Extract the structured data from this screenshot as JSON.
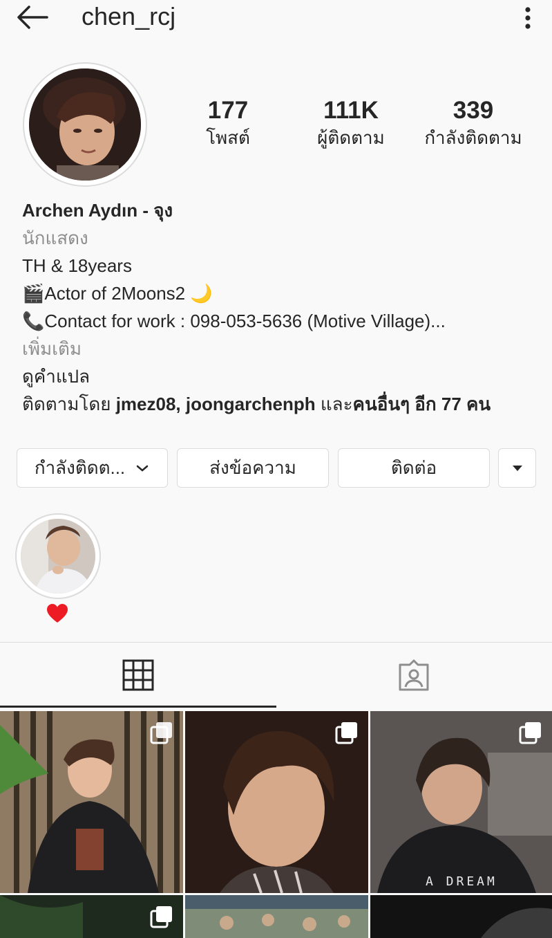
{
  "header": {
    "username": "chen_rcj",
    "back_icon": "arrow-left-icon",
    "more_icon": "more-vertical-icon"
  },
  "profile": {
    "stats": [
      {
        "value": "177",
        "label": "โพสต์"
      },
      {
        "value": "111K",
        "label": "ผู้ติดตาม"
      },
      {
        "value": "339",
        "label": "กำลังติดตาม"
      }
    ],
    "name": "Archen Aydın - จุง",
    "category": "นักแสดง",
    "bio_lines": [
      "TH & 18years",
      "🎬Actor of 2Moons2 🌙",
      "📞Contact for work : 098-053-5636 (Motive Village)..."
    ],
    "more_link": "เพิ่มเติม",
    "translate_link": "ดูคำแปล",
    "followed_by": {
      "prefix": "ติดตามโดย ",
      "users": "jmez08, joongarchenph",
      "middle": " และ",
      "others": "คนอื่นๆ อีก 77 คน"
    }
  },
  "buttons": {
    "following": "กำลังติดต...",
    "message": "ส่งข้อความ",
    "contact": "ติดต่อ"
  },
  "highlight": {
    "label_icon": "heart-icon"
  },
  "tabs": {
    "grid_icon": "grid-icon",
    "tagged_icon": "tagged-person-icon"
  },
  "posts": [
    {
      "caption": ""
    },
    {
      "caption": ""
    },
    {
      "caption": "A DREAM"
    }
  ],
  "colors": {
    "text": "#262626",
    "muted": "#8e8e8e",
    "border": "#dbdbdb",
    "heart": "#ed1c24"
  }
}
